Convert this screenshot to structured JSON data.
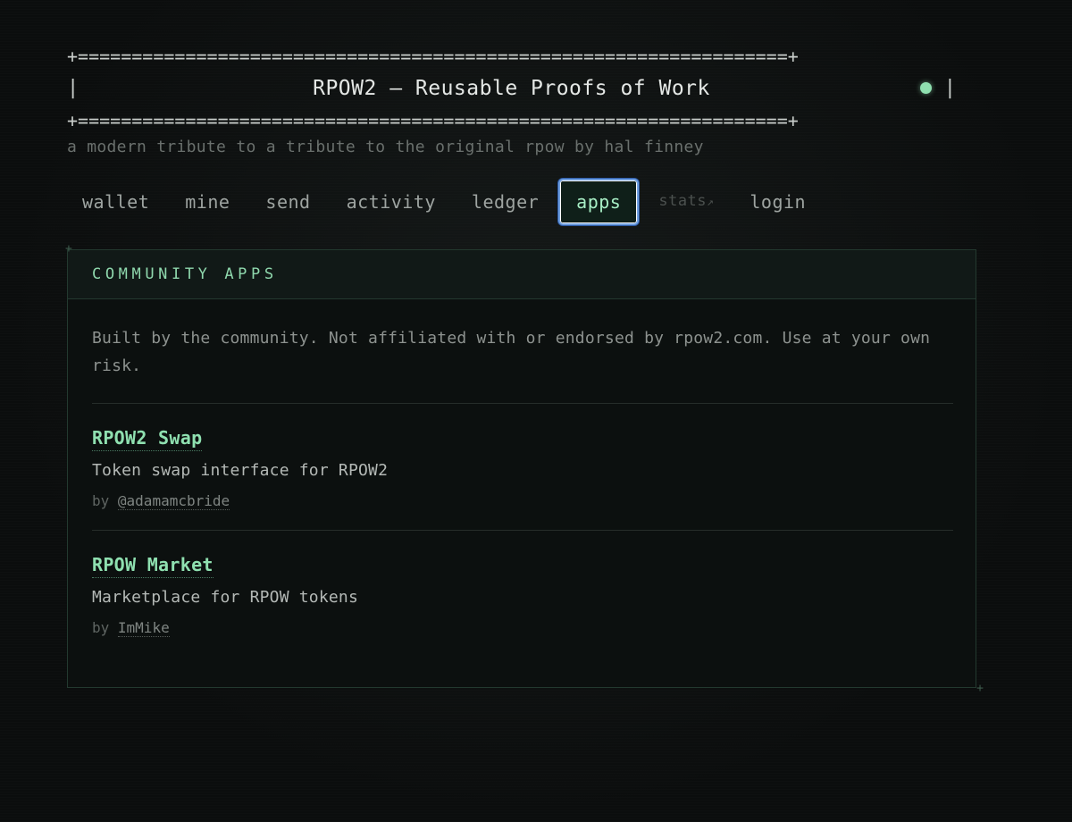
{
  "header": {
    "rule_top": "+==================================================================+",
    "rule_bottom": "+==================================================================+",
    "pipe_left": "|",
    "pipe_right": "|",
    "title": "RPOW2 — Reusable Proofs of Work",
    "status_color": "#8fe0b0",
    "tagline": "a modern tribute to a tribute to the original rpow by hal finney"
  },
  "nav": {
    "items": [
      {
        "label": "wallet"
      },
      {
        "label": "mine"
      },
      {
        "label": "send"
      },
      {
        "label": "activity"
      },
      {
        "label": "ledger"
      },
      {
        "label": "apps",
        "active": true
      },
      {
        "label": "stats",
        "external_icon": "↗",
        "muted": true
      },
      {
        "label": "login"
      }
    ]
  },
  "panel": {
    "heading": "COMMUNITY APPS",
    "corner_top_left": "+",
    "corner_bottom_right": "+",
    "disclaimer": "Built by the community. Not affiliated with or endorsed by rpow2.com. Use at your own risk.",
    "apps": [
      {
        "name": "RPOW2 Swap",
        "description": "Token swap interface for RPOW2",
        "by_label": "by",
        "author": "@adamamcbride"
      },
      {
        "name": "RPOW Market",
        "description": "Marketplace for RPOW tokens",
        "by_label": "by",
        "author": "ImMike"
      }
    ]
  },
  "colors": {
    "accent": "#8fe0b0",
    "background": "#0b0d0d",
    "active_tab_border": "#6f9fe0"
  }
}
